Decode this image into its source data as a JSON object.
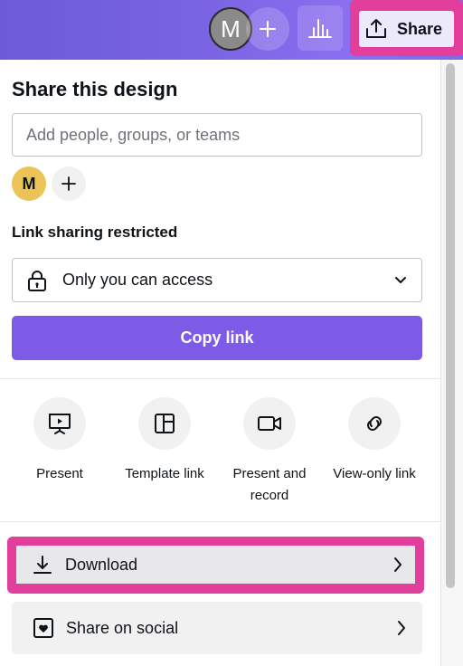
{
  "topbar": {
    "avatar_initial": "M",
    "share_label": "Share",
    "gradient_colors": [
      "#6b5bd9",
      "#8b6ff0"
    ],
    "highlight_color": "#e23f9c"
  },
  "panel": {
    "title": "Share this design",
    "people_input": {
      "placeholder": "Add people, groups, or teams",
      "value": ""
    },
    "collaborator_initial": "M",
    "link_section_label": "Link sharing restricted",
    "access_select": {
      "value": "Only you can access"
    },
    "copy_link_label": "Copy link",
    "accent_color": "#7d5be6"
  },
  "actions": [
    {
      "label": "Present",
      "icon": "present-icon"
    },
    {
      "label": "Template link",
      "icon": "template-icon"
    },
    {
      "label": "Present and record",
      "icon": "video-camera-icon"
    },
    {
      "label": "View-only link",
      "icon": "link-icon"
    }
  ],
  "rows": {
    "download_label": "Download",
    "social_label": "Share on social"
  }
}
